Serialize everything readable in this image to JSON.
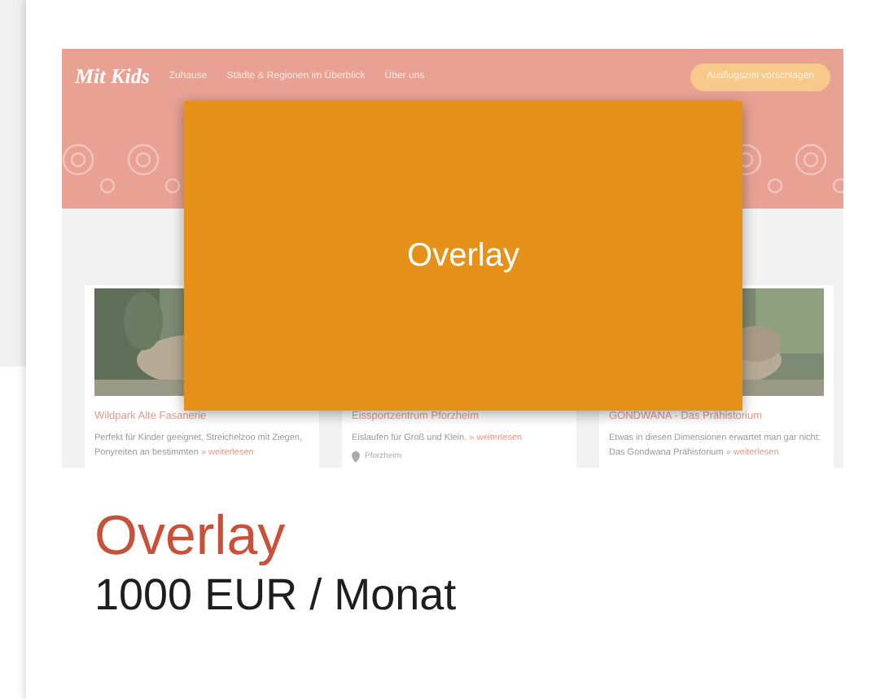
{
  "preview": {
    "logo": "Mit Kids",
    "nav": [
      "Zuhause",
      "Städte & Regionen im Überblick",
      "Über uns"
    ],
    "cta": "Ausflugsziel vorschlagen",
    "cards": [
      {
        "picture": true,
        "title": "Wildpark Alte Fasanerie",
        "text": "Perfekt für Kinder geeignet, Streichelzoo mit Ziegen, Ponyreiten an bestimmten",
        "link": "» weiterlesen"
      },
      {
        "picture": false,
        "title": "Eissportzentrum Pforzheim",
        "text": "Eislaufen für Groß und Klein.",
        "link": "» weiterlesen",
        "location": "Pforzheim"
      },
      {
        "picture": true,
        "title": "GONDWANA - Das Prähistorium",
        "text": "Etwas in diesen Dimensionen erwartet man gar nicht: Das Gondwana Prähistorium",
        "link": "» weiterlesen"
      }
    ]
  },
  "overlay": {
    "label": "Overlay"
  },
  "product": {
    "title": "Overlay",
    "price": "1000 EUR / Monat"
  }
}
